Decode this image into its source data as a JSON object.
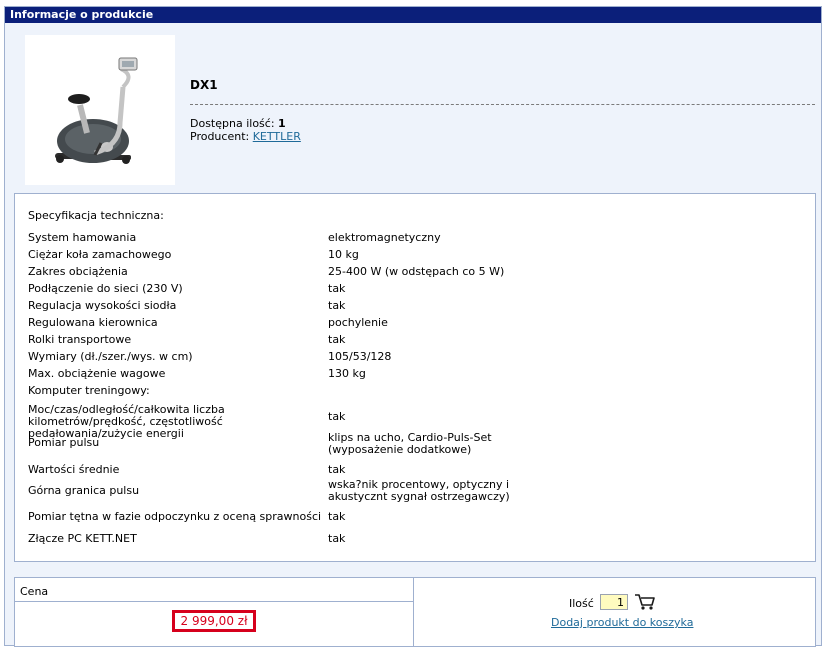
{
  "header": {
    "title": "Informacje o produkcie"
  },
  "product": {
    "name": "DX1",
    "stock_label": "Dostępna ilość:",
    "stock_value": "1",
    "producer_label": "Producent:",
    "producer_value": "KETTLER"
  },
  "spec": {
    "heading": "Specyfikacja techniczna:",
    "rows": [
      {
        "label": "System hamowania",
        "value": "elektromagnetyczny"
      },
      {
        "label": "Ciężar koła zamachowego",
        "value": "10 kg"
      },
      {
        "label": "Zakres obciążenia",
        "value": "25-400 W (w odstępach co 5 W)"
      },
      {
        "label": "Podłączenie do sieci (230 V)",
        "value": "tak"
      },
      {
        "label": "Regulacja wysokości siodła",
        "value": "tak"
      },
      {
        "label": "Regulowana kierownica",
        "value": "pochylenie"
      },
      {
        "label": "Rolki transportowe",
        "value": "tak"
      },
      {
        "label": "Wymiary (dł./szer./wys. w cm)",
        "value": "105/53/128"
      },
      {
        "label": "Max. obciążenie wagowe",
        "value": "130 kg"
      },
      {
        "label": "Komputer treningowy:",
        "value": ""
      },
      {
        "label": "Moc/czas/odległość/całkowita liczba kilometrów/prędkość, częstotliwość pedałowania/zużycie energii",
        "value": "tak"
      },
      {
        "label": "Pomiar pulsu",
        "value": "klips na ucho, Cardio-Puls-Set (wyposażenie dodatkowe)"
      },
      {
        "label": "Wartości średnie",
        "value": "tak"
      },
      {
        "label": "Górna granica pulsu",
        "value": "wska?nik procentowy, optyczny i akustycznt sygnał ostrzegawczy)"
      },
      {
        "label": "Pomiar tętna w fazie odpoczynku z oceną sprawności",
        "value": "tak"
      },
      {
        "label": "Złącze PC KETT.NET",
        "value": "tak"
      }
    ]
  },
  "price": {
    "label": "Cena",
    "value": "2 999,00 zł"
  },
  "cart": {
    "qty_label": "Ilość",
    "qty_value": "1",
    "add_link": "Dodaj produkt do koszyka"
  },
  "colors": {
    "title_bar": "#0b1f7a",
    "panel_bg": "#eef3fb",
    "price_red": "#d6001c",
    "link": "#1f6a99"
  }
}
